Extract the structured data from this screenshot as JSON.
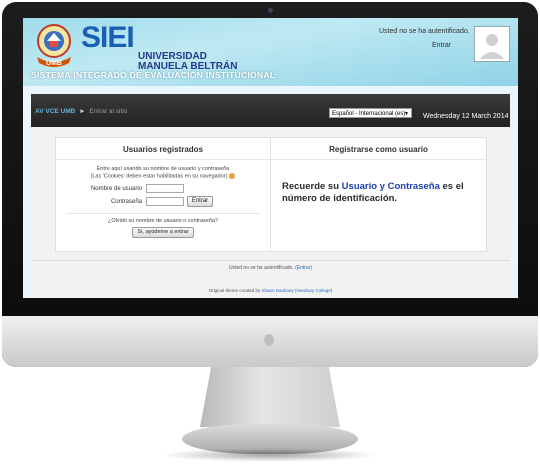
{
  "header": {
    "brand_siei": "SIEI",
    "brand_line1": "UNIVERSIDAD",
    "brand_line2": "MANUELA BELTRÁN",
    "brand_sub": "SISTEMA INTEGRADO DE EVALUACIÓN INSTITUCIONAL",
    "logo_text": "UMB",
    "login_status": "Usted no se ha autentificado.",
    "login_link": "Entrar"
  },
  "navbar": {
    "breadcrumb_home": "AV VCE UMB",
    "breadcrumb_sep": "►",
    "breadcrumb_current": "Entrar al sitio",
    "language": "Español - Internacional (es)",
    "date": "Wednesday 12 March 2014"
  },
  "login": {
    "title": "Usuarios registrados",
    "intro_line1": "Entre aquí usando su nombre de usuario y contraseña",
    "intro_line2": "(Las 'Cookies' deben estar habilitadas en su navegador)",
    "username_label": "Nombre de usuario",
    "password_label": "Contraseña",
    "username_value": "",
    "password_value": "",
    "submit_label": "Entrar",
    "forgot_question": "¿Olvidó su nombre de usuario o contraseña?",
    "forgot_button": "Sí, ayúdeme a entrar"
  },
  "signup": {
    "title": "Registrarse como usuario",
    "message_pre": "Recuerde su ",
    "message_highlight": "Usuario y Contraseña",
    "message_post": " es el número de identificación."
  },
  "footer": {
    "status_text": "Usted no se ha autentificado.",
    "status_link": "(Entrar)",
    "theme_pre": "Original theme created by ",
    "theme_link": "Shaun Daubney (Newbury College)"
  },
  "colors": {
    "header_bg": "#9fdcea",
    "navbar_bg": "#2b2b2b",
    "accent_blue": "#1a5fb4",
    "link_blue": "#2a6cc0"
  }
}
